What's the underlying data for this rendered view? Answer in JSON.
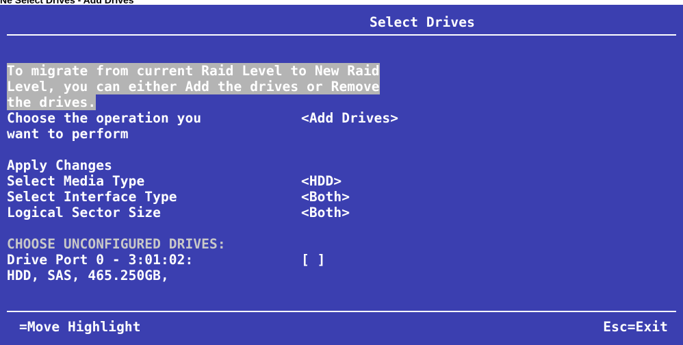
{
  "caption": "Ne Select Drives - Add Drives",
  "screen": {
    "title": "Select Drives",
    "info_lines": [
      "To migrate from current Raid Level to New Raid",
      "Level, you can either Add the drives or Remove",
      "the drives."
    ],
    "operation": {
      "label_line1": "Choose the operation you",
      "label_line2": "want to perform",
      "value": "<Add Drives>"
    },
    "apply_changes": "Apply Changes",
    "settings": [
      {
        "label": "Select Media Type",
        "value": "<HDD>"
      },
      {
        "label": "Select Interface Type",
        "value": "<Both>"
      },
      {
        "label": "Logical Sector Size",
        "value": "<Both>"
      }
    ],
    "section_header": "CHOOSE UNCONFIGURED DRIVES:",
    "drive": {
      "label": "Drive Port 0 - 3:01:02:",
      "checkbox": "[ ]",
      "details": "HDD, SAS, 465.250GB,"
    },
    "footer": {
      "left": "=Move Highlight",
      "right": "Esc=Exit"
    }
  },
  "colors": {
    "screen_background": "#3b3fb0",
    "text": "#ffffff",
    "highlight": "#b4b4b4"
  }
}
